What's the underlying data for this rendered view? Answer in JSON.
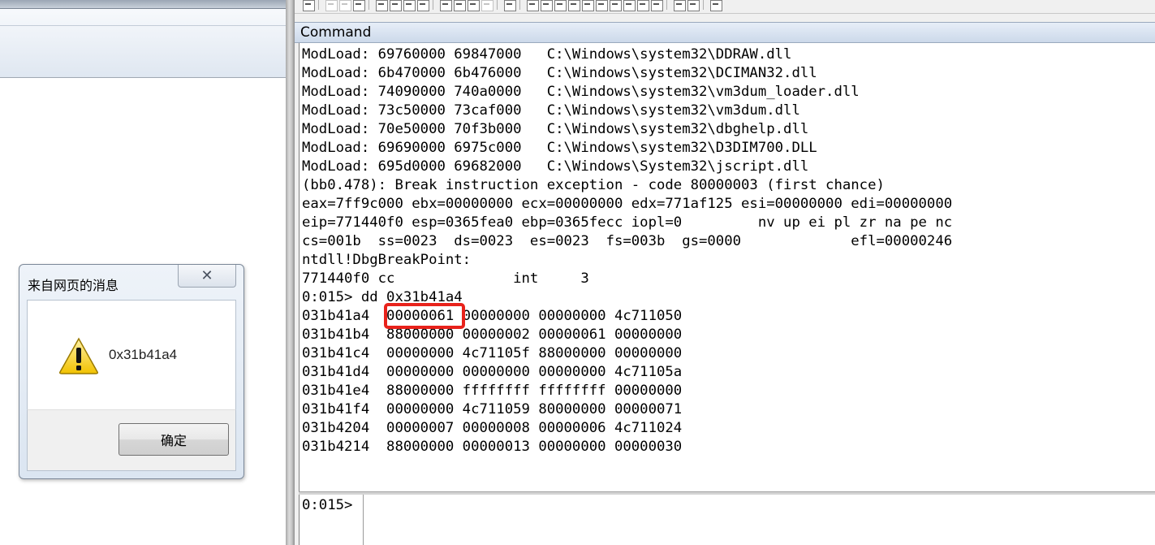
{
  "debugger": {
    "title": "Command",
    "prompt": "0:015>",
    "input_value": "",
    "output_lines": [
      "ModLoad: 69760000 69847000   C:\\Windows\\system32\\DDRAW.dll",
      "ModLoad: 6b470000 6b476000   C:\\Windows\\system32\\DCIMAN32.dll",
      "ModLoad: 74090000 740a0000   C:\\Windows\\system32\\vm3dum_loader.dll",
      "ModLoad: 73c50000 73caf000   C:\\Windows\\system32\\vm3dum.dll",
      "ModLoad: 70e50000 70f3b000   C:\\Windows\\system32\\dbghelp.dll",
      "ModLoad: 69690000 6975c000   C:\\Windows\\system32\\D3DIM700.DLL",
      "ModLoad: 695d0000 69682000   C:\\Windows\\System32\\jscript.dll",
      "(bb0.478): Break instruction exception - code 80000003 (first chance)",
      "eax=7ff9c000 ebx=00000000 ecx=00000000 edx=771af125 esi=00000000 edi=00000000",
      "eip=771440f0 esp=0365fea0 ebp=0365fecc iopl=0         nv up ei pl zr na pe nc",
      "cs=001b  ss=0023  ds=0023  es=0023  fs=003b  gs=0000             efl=00000246",
      "ntdll!DbgBreakPoint:",
      "771440f0 cc              int     3",
      "0:015> dd 0x31b41a4",
      "031b41a4  00000061 00000000 00000000 4c711050",
      "031b41b4  88000000 00000002 00000061 00000000",
      "031b41c4  00000000 4c71105f 88000000 00000000",
      "031b41d4  00000000 00000000 00000000 4c71105a",
      "031b41e4  88000000 ffffffff ffffffff 00000000",
      "031b41f4  00000000 4c711059 80000000 00000071",
      "031b4204  00000007 00000008 00000006 4c711024",
      "031b4214  88000000 00000013 00000000 00000030"
    ],
    "highlight_color": "#e8221b"
  },
  "dialog": {
    "title": "来自网页的消息",
    "close_glyph": "✕",
    "message": "0x31b41a4",
    "ok_label": "确定",
    "icon": "warning-icon"
  }
}
